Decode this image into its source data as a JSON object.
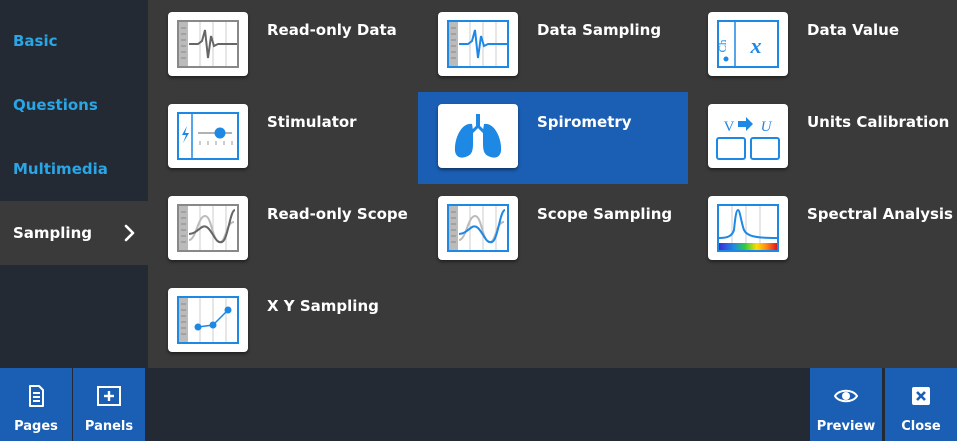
{
  "sidebar": {
    "categories": [
      {
        "label": "Basic"
      },
      {
        "label": "Questions"
      },
      {
        "label": "Multimedia"
      },
      {
        "label": "Sampling"
      }
    ],
    "active": "Sampling"
  },
  "panels": [
    {
      "label": "Read-only Data",
      "icon": "read-only-data-icon"
    },
    {
      "label": "Data Sampling",
      "icon": "data-sampling-icon"
    },
    {
      "label": "Data Value",
      "icon": "data-value-icon"
    },
    {
      "label": "Stimulator",
      "icon": "stimulator-icon"
    },
    {
      "label": "Spirometry",
      "icon": "lungs-icon"
    },
    {
      "label": "Units Calibration",
      "icon": "units-calibration-icon"
    },
    {
      "label": "Read-only Scope",
      "icon": "read-only-scope-icon"
    },
    {
      "label": "Scope Sampling",
      "icon": "scope-sampling-icon"
    },
    {
      "label": "Spectral Analysis",
      "icon": "spectral-analysis-icon"
    },
    {
      "label": "X Y Sampling",
      "icon": "xy-sampling-icon"
    }
  ],
  "selected_panel": "Spirometry",
  "icon_text": {
    "data_value_ch": "Ch",
    "data_value_x": "x",
    "units_v": "V",
    "units_u": "U"
  },
  "bottom": {
    "pages_label": "Pages",
    "panels_label": "Panels",
    "preview_label": "Preview",
    "close_label": "Close"
  },
  "colors": {
    "accent": "#1a5fb4",
    "sidebar_text": "#2aa5e6",
    "icon_blue": "#1e88e5",
    "background": "#3a3a3a",
    "bar": "#232a33"
  }
}
